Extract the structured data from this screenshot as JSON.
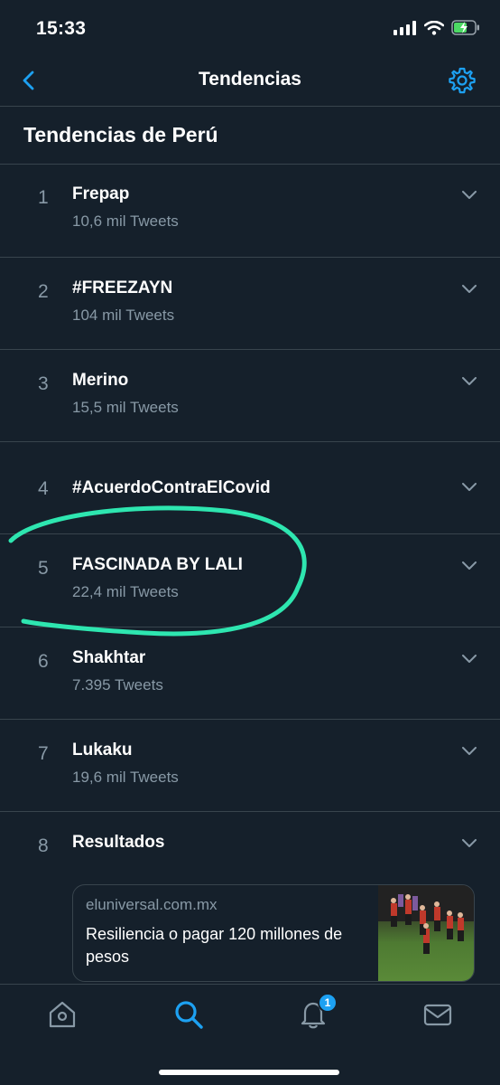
{
  "status": {
    "time": "15:33"
  },
  "nav": {
    "title": "Tendencias"
  },
  "section": {
    "title": "Tendencias de Perú"
  },
  "trends": [
    {
      "rank": "1",
      "name": "Frepap",
      "count": "10,6 mil Tweets"
    },
    {
      "rank": "2",
      "name": "#FREEZAYN",
      "count": "104 mil Tweets"
    },
    {
      "rank": "3",
      "name": "Merino",
      "count": "15,5 mil Tweets"
    },
    {
      "rank": "4",
      "name": "#AcuerdoContraElCovid",
      "count": ""
    },
    {
      "rank": "5",
      "name": "FASCINADA BY LALI",
      "count": "22,4 mil Tweets"
    },
    {
      "rank": "6",
      "name": "Shakhtar",
      "count": "7.395 Tweets"
    },
    {
      "rank": "7",
      "name": "Lukaku",
      "count": "19,6 mil Tweets"
    },
    {
      "rank": "8",
      "name": "Resultados",
      "count": ""
    }
  ],
  "card": {
    "domain": "eluniversal.com.mx",
    "headline": "Resiliencia o pagar 120 millones de pesos"
  },
  "tabbar": {
    "items": [
      "home-icon",
      "search-icon",
      "notifications-icon",
      "messages-icon"
    ],
    "notification_badge": "1"
  },
  "colors": {
    "background": "#15202b",
    "accent": "#1da1f2",
    "highlight_annotation": "#2ee6b0"
  }
}
